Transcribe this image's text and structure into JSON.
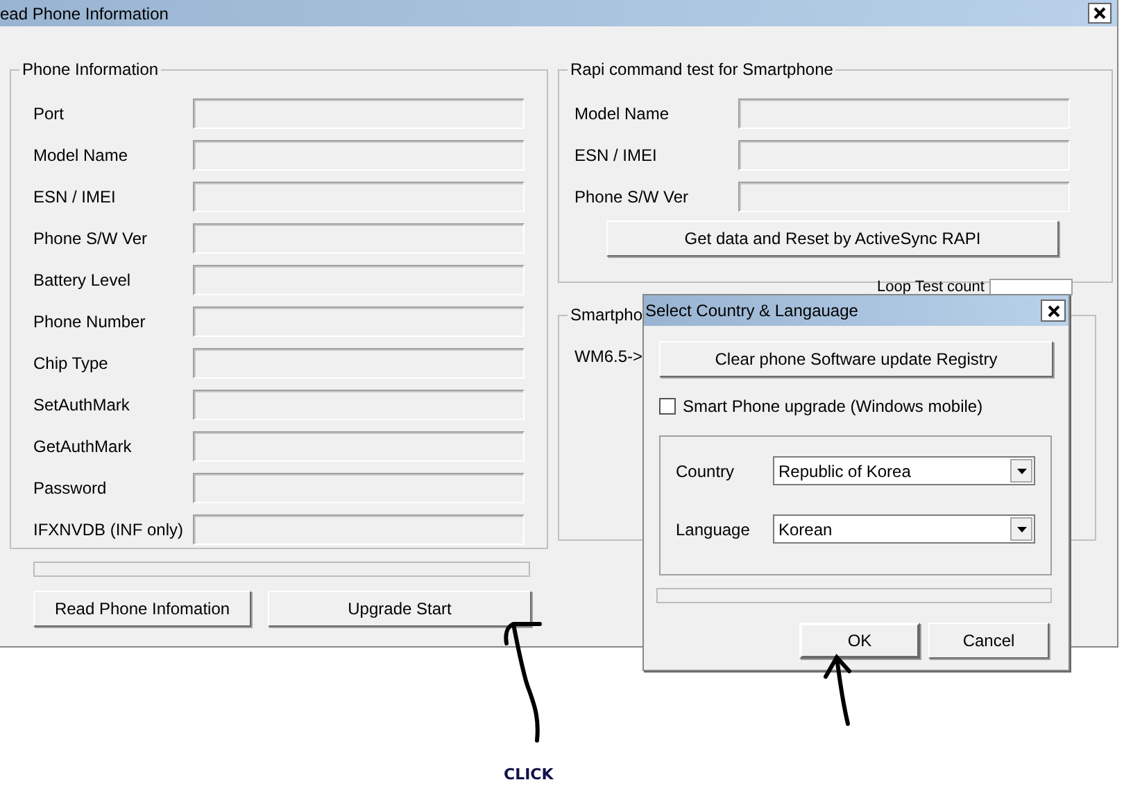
{
  "window": {
    "title": "ead Phone Information"
  },
  "phone_information": {
    "title": "Phone Information",
    "fields": [
      {
        "label": "Port"
      },
      {
        "label": "Model Name"
      },
      {
        "label": "ESN / IMEI"
      },
      {
        "label": "Phone S/W Ver"
      },
      {
        "label": "Battery Level"
      },
      {
        "label": "Phone Number"
      },
      {
        "label": "Chip Type"
      },
      {
        "label": "SetAuthMark"
      },
      {
        "label": "GetAuthMark"
      },
      {
        "label": "Password"
      },
      {
        "label": "IFXNVDB (INF only)"
      }
    ],
    "progress": {
      "level": 0
    },
    "buttons": [
      "Read Phone Infomation",
      "Upgrade Start"
    ]
  },
  "rapi": {
    "title": "Rapi command test for Smartphone",
    "fields": [
      {
        "label": "Model Name"
      },
      {
        "label": "ESN / IMEI"
      },
      {
        "label": "Phone S/W Ver"
      }
    ],
    "button": "Get data and Reset by ActiveSync RAPI"
  },
  "loop_test": {
    "label": "Loop Test count"
  },
  "smartphone_group": {
    "title": "Smartpho",
    "text": "WM6.5->"
  },
  "dialog": {
    "title": "Select Country & Langauage",
    "clear_button": "Clear phone Software update Registry",
    "checkbox": {
      "label": "Smart Phone upgrade (Windows mobile)",
      "checked": false
    },
    "selects": [
      {
        "label": "Country",
        "value": "Republic of Korea"
      },
      {
        "label": "Language",
        "value": "Korean"
      }
    ],
    "progress": {
      "level": 0
    },
    "buttons": [
      "OK",
      "Cancel"
    ]
  },
  "annotation": {
    "text": "CLICK"
  }
}
